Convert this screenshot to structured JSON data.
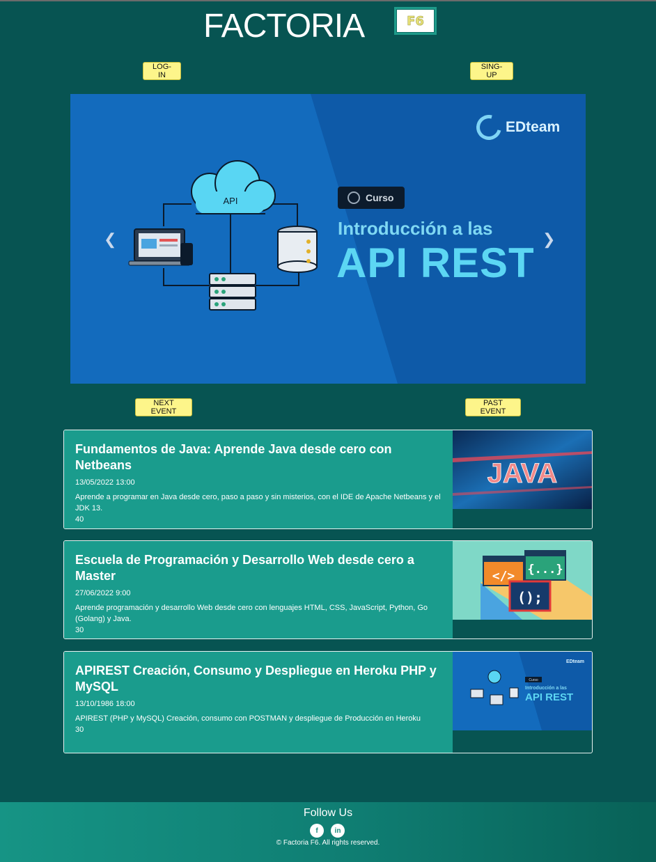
{
  "header": {
    "title": "FACTORIA",
    "logo_text": "F6",
    "login_label": "LOG-IN",
    "signup_label": "SING-UP"
  },
  "carousel": {
    "brand": "EDteam",
    "badge": "Curso",
    "subtitle": "Introducción a las",
    "headline": "API REST",
    "cloud_label": "API",
    "prev_icon": "chevron-left-icon",
    "next_icon": "chevron-right-icon"
  },
  "event_tabs": {
    "next_label": "NEXT EVENT",
    "past_label": "PAST EVENT"
  },
  "events": [
    {
      "title": "Fundamentos de Java: Aprende Java desde cero con Netbeans",
      "date": "13/05/2022 13:00",
      "description": "Aprende a programar en Java desde cero, paso a paso y sin misterios, con el IDE de Apache Netbeans y el JDK 13.",
      "count": "40",
      "image_text": "JAVA"
    },
    {
      "title": "Escuela de Programación y Desarrollo Web desde cero a Master",
      "date": "27/06/2022 9:00",
      "description": "Aprende programación y desarrollo Web desde cero con lenguajes HTML, CSS, JavaScript, Python, Go (Golang) y Java.",
      "count": "30",
      "image_text": [
        "</>",
        "{...}",
        "();"
      ]
    },
    {
      "title": "APIREST Creación, Consumo y Despliegue en Heroku PHP y MySQL",
      "date": "13/10/1986 18:00",
      "description": "APIREST (PHP y MySQL) Creación, consumo con POSTMAN y despliegue de Producción en Heroku",
      "count": "30",
      "image_text": [
        "EDteam",
        "Curso",
        "Introducción a las",
        "API REST"
      ]
    }
  ],
  "footer": {
    "title": "Follow Us",
    "facebook": "f",
    "linkedin": "in",
    "copyright": "© Factoria F6. All rights reserved."
  },
  "colors": {
    "background": "#075452",
    "card": "#1a9c8d",
    "button": "#fdf58a"
  }
}
